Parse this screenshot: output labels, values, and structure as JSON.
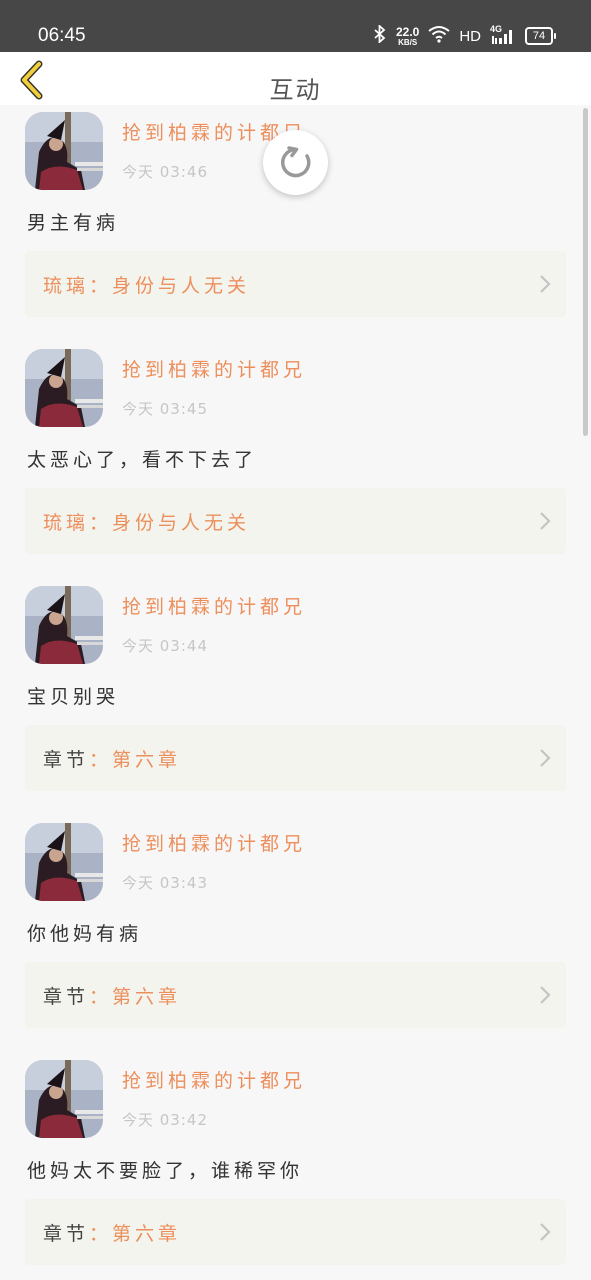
{
  "status_bar": {
    "time": "06:45",
    "net_speed_value": "22.0",
    "net_speed_unit": "KB/S",
    "network_hd": "HD",
    "network_type": "4G",
    "battery": "74"
  },
  "header": {
    "title": "互动"
  },
  "comments": [
    {
      "user": "抢到柏霖的计都兄",
      "time": "今天 03:46",
      "text": "男主有病",
      "ref_label": "琉璃",
      "ref_sep": "：",
      "ref_value": "身份与人无关"
    },
    {
      "user": "抢到柏霖的计都兄",
      "time": "今天 03:45",
      "text": "太恶心了，看不下去了",
      "ref_label": "琉璃",
      "ref_sep": "：",
      "ref_value": "身份与人无关"
    },
    {
      "user": "抢到柏霖的计都兄",
      "time": "今天 03:44",
      "text": "宝贝别哭",
      "ref_label": "章节",
      "ref_sep": "：",
      "ref_value": "第六章"
    },
    {
      "user": "抢到柏霖的计都兄",
      "time": "今天 03:43",
      "text": "你他妈有病",
      "ref_label": "章节",
      "ref_sep": "：",
      "ref_value": "第六章"
    },
    {
      "user": "抢到柏霖的计都兄",
      "time": "今天 03:42",
      "text": "他妈太不要脸了，谁稀罕你",
      "ref_label": "章节",
      "ref_sep": "：",
      "ref_value": "第六章"
    }
  ],
  "colors": {
    "accent": "#ec8f5c",
    "back_arrow": "#f2cf38",
    "status_bar": "#474747"
  },
  "icons": {
    "back": "back-arrow-icon",
    "chevron": "chevron-right-icon",
    "refresh": "refresh-icon"
  }
}
